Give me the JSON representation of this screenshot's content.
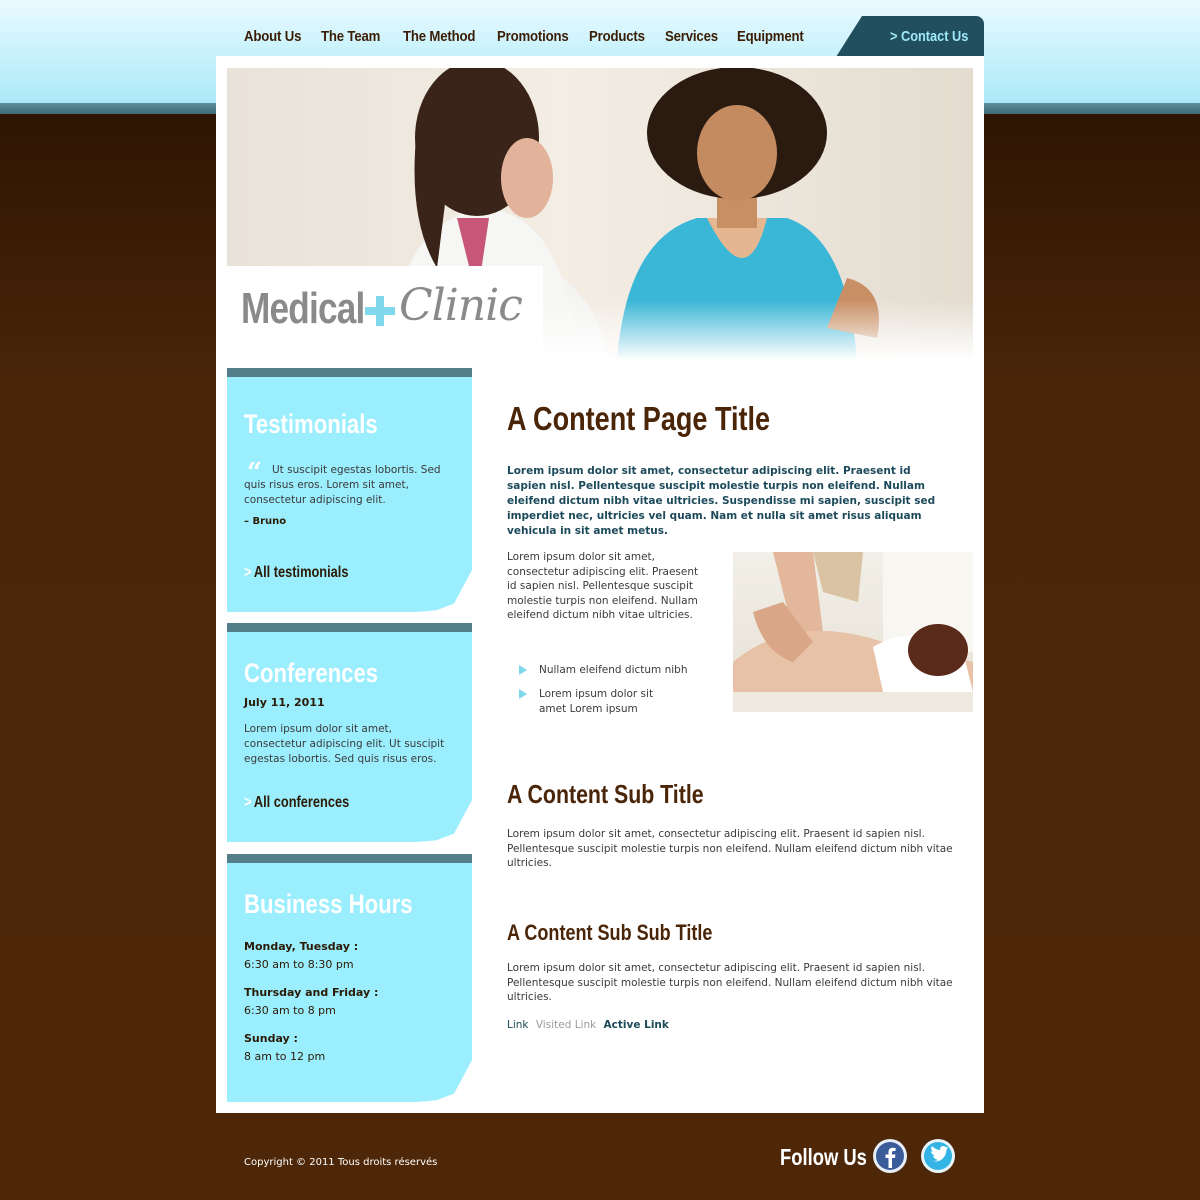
{
  "nav": {
    "items": [
      "About Us",
      "The Team",
      "The Method",
      "Promotions",
      "Products",
      "Services",
      "Equipment"
    ],
    "contact": "> Contact Us"
  },
  "logo": {
    "medical": "Medical",
    "clinic": "Clinic"
  },
  "testimonials": {
    "title": "Testimonials",
    "quote": "Ut suscipit egestas lobortis. Sed quis risus eros. Lorem sit amet, consectetur adipiscing elit.",
    "author": "– Bruno",
    "link": "All testimonials"
  },
  "conferences": {
    "title": "Conferences",
    "date": "July 11, 2011",
    "text": "Lorem ipsum dolor sit amet, consectetur adipiscing elit. Ut suscipit egestas lobortis. Sed quis risus eros.",
    "link": "All conferences"
  },
  "hours": {
    "title": "Business Hours",
    "rows": [
      {
        "label": "Monday, Tuesday :",
        "value": "6:30 am to 8:30 pm"
      },
      {
        "label": "Thursday and Friday :",
        "value": "6:30 am to 8 pm"
      },
      {
        "label": "Sunday :",
        "value": "8 am to 12 pm"
      }
    ]
  },
  "content": {
    "title": "A Content Page Title",
    "intro": "Lorem ipsum dolor sit amet, consectetur adipiscing elit. Praesent id sapien nisl. Pellentesque suscipit molestie turpis non eleifend. Nullam eleifend dictum nibh vitae ultricies. Suspendisse mi sapien, suscipit sed imperdiet nec, ultricies vel quam. Nam et nulla sit amet risus aliquam vehicula in sit amet metus.",
    "para1": "Lorem ipsum dolor sit amet, consectetur adipiscing elit. Praesent id sapien nisl. Pellentesque suscipit molestie turpis non eleifend. Nullam eleifend dictum nibh vitae ultricies.",
    "bullets": [
      "Nullam eleifend dictum nibh",
      "Lorem ipsum dolor sit amet Lorem ipsum"
    ],
    "subtitle": "A Content Sub Title",
    "para2": "Lorem ipsum dolor sit amet, consectetur adipiscing elit. Praesent id sapien nisl. Pellentesque suscipit molestie turpis non eleifend. Nullam eleifend dictum nibh vitae ultricies.",
    "subsubtitle": "A Content Sub Sub Title",
    "para3": "Lorem ipsum dolor sit amet, consectetur adipiscing elit. Praesent id sapien nisl. Pellentesque suscipit molestie turpis non eleifend. Nullam eleifend dictum nibh vitae ultricies.",
    "links": {
      "link": "Link",
      "visited": "Visited Link",
      "active": "Active Link"
    }
  },
  "footer": {
    "copyright": "Copyright © 2011 Tous droits réservés",
    "follow": "Follow Us"
  },
  "colors": {
    "accent": "#9beefd",
    "brown": "#4a2508",
    "nav_tab": "#224f5e",
    "link": "#1c4a5a",
    "visited": "#9a9a9a"
  },
  "icons": [
    "facebook-icon",
    "twitter-icon",
    "plus-icon",
    "quote-icon",
    "chevron-right-icon",
    "bullet-triangle-icon"
  ]
}
